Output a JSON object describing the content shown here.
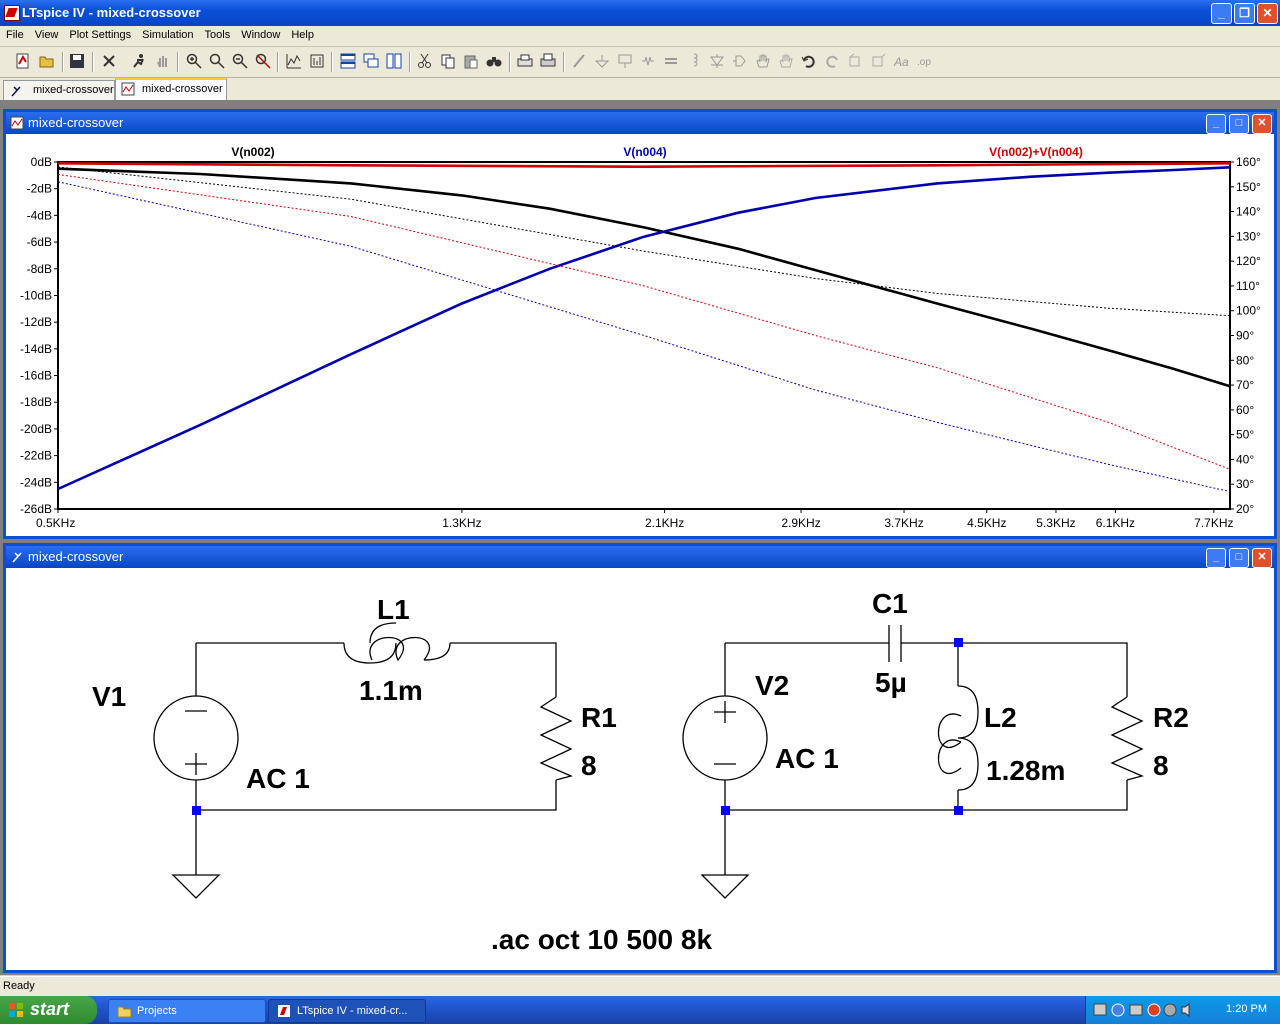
{
  "app": {
    "title": "LTspice IV - mixed-crossover"
  },
  "menu": [
    "File",
    "View",
    "Plot Settings",
    "Simulation",
    "Tools",
    "Window",
    "Help"
  ],
  "tabs": [
    {
      "label": "mixed-crossover",
      "icon": "schematic-icon",
      "active": false
    },
    {
      "label": "mixed-crossover",
      "icon": "waveform-icon",
      "active": true
    }
  ],
  "plot_window": {
    "title": "mixed-crossover"
  },
  "schematic_window": {
    "title": "mixed-crossover"
  },
  "chart_data": {
    "type": "line",
    "x_scale": "log",
    "x_range": [
      500,
      8000
    ],
    "x_ticks": [
      "0.5KHz",
      "1.3KHz",
      "2.1KHz",
      "2.9KHz",
      "3.7KHz",
      "4.5KHz",
      "5.3KHz",
      "6.1KHz",
      "7.7KHz"
    ],
    "x_tick_values": [
      500,
      1300,
      2100,
      2900,
      3700,
      4500,
      5300,
      6100,
      7700
    ],
    "y_left_ticks": [
      "0dB",
      "-2dB",
      "-4dB",
      "-6dB",
      "-8dB",
      "-10dB",
      "-12dB",
      "-14dB",
      "-16dB",
      "-18dB",
      "-20dB",
      "-22dB",
      "-24dB",
      "-26dB"
    ],
    "y_left_range": [
      -26,
      0
    ],
    "y_right_ticks": [
      "160°",
      "150°",
      "140°",
      "130°",
      "120°",
      "110°",
      "100°",
      "90°",
      "80°",
      "70°",
      "60°",
      "50°",
      "40°",
      "30°",
      "20°"
    ],
    "y_right_range": [
      20,
      160
    ],
    "series": [
      {
        "name": "V(n002)",
        "color": "#000000",
        "kind": "magnitude",
        "x": [
          500,
          700,
          1000,
          1300,
          1600,
          2000,
          2500,
          3000,
          4000,
          5000,
          6000,
          7000,
          8000
        ],
        "y": [
          -0.5,
          -0.9,
          -1.6,
          -2.5,
          -3.5,
          -4.9,
          -6.5,
          -8.1,
          -10.6,
          -12.5,
          -14.1,
          -15.5,
          -16.8
        ]
      },
      {
        "name": "V(n004)",
        "color": "#0000b0",
        "kind": "magnitude",
        "x": [
          500,
          700,
          1000,
          1300,
          1600,
          2000,
          2500,
          3000,
          4000,
          5000,
          6000,
          7000,
          8000
        ],
        "y": [
          -24.5,
          -19.7,
          -14.4,
          -10.6,
          -8.0,
          -5.6,
          -3.8,
          -2.7,
          -1.6,
          -1.1,
          -0.8,
          -0.6,
          -0.4
        ]
      },
      {
        "name": "V(n002)+V(n004)",
        "color": "#d00000",
        "kind": "magnitude",
        "x": [
          500,
          1000,
          2000,
          4000,
          8000
        ],
        "y": [
          -0.1,
          -0.25,
          -0.35,
          -0.25,
          -0.1
        ]
      },
      {
        "name": "V(n002) phase",
        "color": "#000000",
        "kind": "phase",
        "x": [
          500,
          1000,
          2000,
          3000,
          4000,
          6000,
          8000
        ],
        "y": [
          158,
          145,
          124,
          113,
          107,
          101,
          98
        ]
      },
      {
        "name": "V(n004) phase",
        "color": "#0000b0",
        "kind": "phase",
        "x": [
          500,
          1000,
          2000,
          3000,
          4000,
          6000,
          8000
        ],
        "y": [
          152,
          126,
          90,
          68,
          55,
          38,
          27
        ]
      },
      {
        "name": "V(n002)+V(n004) phase",
        "color": "#d00000",
        "kind": "phase",
        "x": [
          500,
          1000,
          2000,
          3000,
          4000,
          6000,
          8000
        ],
        "y": [
          155,
          138,
          110,
          90,
          77,
          55,
          36
        ]
      }
    ]
  },
  "schematic": {
    "v1": {
      "name": "V1",
      "value": "AC 1"
    },
    "l1": {
      "name": "L1",
      "value": "1.1m"
    },
    "r1": {
      "name": "R1",
      "value": "8"
    },
    "v2": {
      "name": "V2",
      "value": "AC 1"
    },
    "c1": {
      "name": "C1",
      "value": "5µ"
    },
    "l2": {
      "name": "L2",
      "value": "1.28m"
    },
    "r2": {
      "name": "R2",
      "value": "8"
    },
    "directive": ".ac oct 10 500 8k"
  },
  "status": {
    "text": "Ready"
  },
  "taskbar": {
    "start": "start",
    "tasks": [
      {
        "label": "Projects",
        "icon": "folder-icon"
      },
      {
        "label": "LTspice IV - mixed-cr...",
        "icon": "ltspice-icon"
      }
    ],
    "clock": "1:20 PM"
  }
}
